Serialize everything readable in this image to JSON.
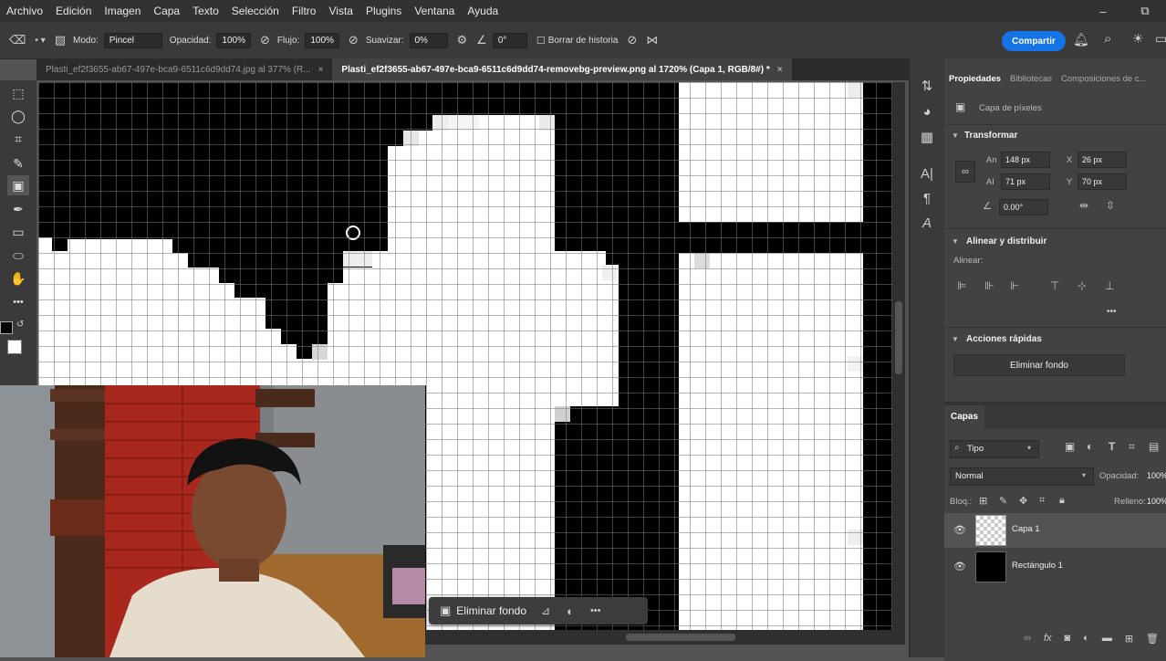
{
  "menu": [
    "Archivo",
    "Edición",
    "Imagen",
    "Capa",
    "Texto",
    "Selección",
    "Filtro",
    "Vista",
    "Plugins",
    "Ventana",
    "Ayuda"
  ],
  "window_controls": {
    "minimize": "–",
    "restore": "⧉"
  },
  "options_bar": {
    "mode_label": "Modo:",
    "mode_value": "Pincel",
    "opacity_label": "Opacidad:",
    "opacity_value": "100%",
    "flow_label": "Flujo:",
    "flow_value": "100%",
    "smooth_label": "Suavizar:",
    "smooth_value": "0%",
    "angle_value": "0°",
    "erase_history_label": "Borrar de historia",
    "share_label": "Compartir"
  },
  "tabs": [
    {
      "label": "Plasti_ef2f3655-ab67-497e-bca9-6511c6d9dd74.jpg al 377% (R...",
      "close": "×",
      "active": false
    },
    {
      "label": "Plasti_ef2f3655-ab67-497e-bca9-6511c6d9dd74-removebg-preview.png al 1720% (Capa 1, RGB/8#) *",
      "close": "×",
      "active": true
    }
  ],
  "context_bar": {
    "remove_bg_label": "Eliminar fondo",
    "more": "•••"
  },
  "properties": {
    "tabs": [
      "Propiedades",
      "Bibliotecas",
      "Composiciones de c..."
    ],
    "layer_type": "Capa de píxeles",
    "transform_title": "Transformar",
    "w_label": "An",
    "w_value": "148 px",
    "h_label": "Al",
    "h_value": "71 px",
    "x_label": "X",
    "x_value": "26 px",
    "y_label": "Y",
    "y_value": "70 px",
    "angle_value": "0.00°",
    "align_title": "Alinear y distribuir",
    "align_label": "Alinear:",
    "more": "•••",
    "quick_actions_title": "Acciones rápidas",
    "remove_bg_button": "Eliminar fondo"
  },
  "layers_panel": {
    "title": "Capas",
    "filter_label": "Tipo",
    "blend_mode": "Normal",
    "opacity_label": "Opacidad:",
    "opacity_value": "100%",
    "lock_label": "Bloq.:",
    "fill_label": "Relleno:",
    "fill_value": "100%",
    "layers": [
      {
        "name": "Capa 1",
        "selected": true
      },
      {
        "name": "Rectángulo 1",
        "selected": false
      }
    ]
  },
  "colors": {
    "accent": "#1473e6",
    "panel": "#424242",
    "canvas_black": "#000000",
    "canvas_white": "#ffffff"
  }
}
